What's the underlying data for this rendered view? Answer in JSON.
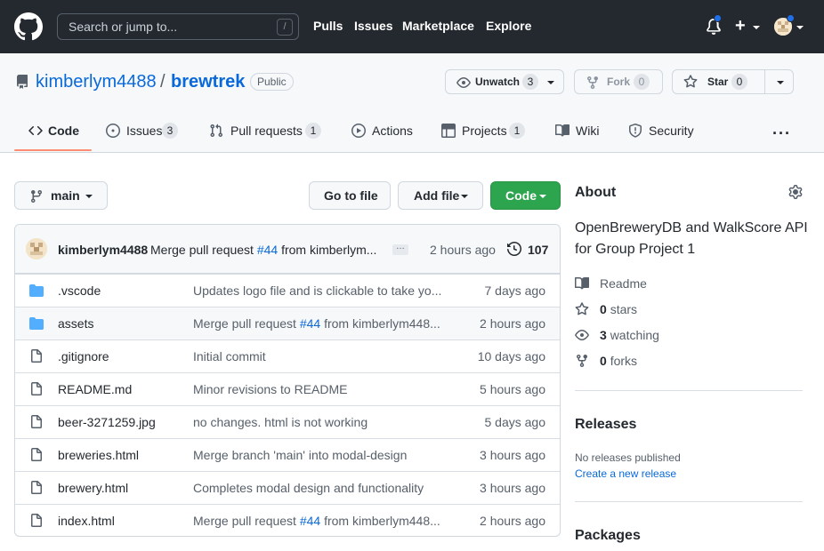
{
  "topbar": {
    "search_placeholder": "Search or jump to...",
    "slash_key": "/",
    "nav": [
      "Pulls",
      "Issues",
      "Marketplace",
      "Explore"
    ]
  },
  "repo": {
    "owner": "kimberlym4488",
    "separator": "/",
    "name": "brewtrek",
    "visibility": "Public",
    "unwatch_label": "Unwatch",
    "unwatch_count": "3",
    "fork_label": "Fork",
    "fork_count": "0",
    "star_label": "Star",
    "star_count": "0"
  },
  "tabs": [
    {
      "label": "Code",
      "icon": "code-icon"
    },
    {
      "label": "Issues",
      "count": "3",
      "icon": "issue-icon"
    },
    {
      "label": "Pull requests",
      "count": "1",
      "icon": "pull-request-icon"
    },
    {
      "label": "Actions",
      "icon": "play-icon"
    },
    {
      "label": "Projects",
      "count": "1",
      "icon": "project-icon"
    },
    {
      "label": "Wiki",
      "icon": "book-icon"
    },
    {
      "label": "Security",
      "icon": "shield-icon"
    }
  ],
  "toolbar": {
    "branch": "main",
    "go_to_file": "Go to file",
    "add_file": "Add file",
    "code": "Code"
  },
  "commit": {
    "author": "kimberlym4488",
    "message_prefix": "Merge pull request",
    "pr_link": "#44",
    "message_suffix": "from kimberlym...",
    "time": "2 hours ago",
    "count": "107"
  },
  "files": [
    {
      "type": "dir",
      "name": ".vscode",
      "message": "Updates logo file and is clickable to take yo...",
      "time": "7 days ago"
    },
    {
      "type": "dir",
      "name": "assets",
      "message_prefix": "Merge pull request ",
      "link": "#44",
      "message_suffix": " from kimberlym448...",
      "time": "2 hours ago"
    },
    {
      "type": "file",
      "name": ".gitignore",
      "message": "Initial commit",
      "time": "10 days ago"
    },
    {
      "type": "file",
      "name": "README.md",
      "message": "Minor revisions to README",
      "time": "5 hours ago"
    },
    {
      "type": "file",
      "name": "beer-3271259.jpg",
      "message": "no changes. html is not working",
      "time": "5 days ago"
    },
    {
      "type": "file",
      "name": "breweries.html",
      "message": "Merge branch 'main' into modal-design",
      "time": "3 hours ago"
    },
    {
      "type": "file",
      "name": "brewery.html",
      "message": "Completes modal design and functionality",
      "time": "3 hours ago"
    },
    {
      "type": "file",
      "name": "index.html",
      "message_prefix": "Merge pull request ",
      "link": "#44",
      "message_suffix": " from kimberlym448...",
      "time": "2 hours ago"
    }
  ],
  "about": {
    "title": "About",
    "description": "OpenBreweryDB and WalkScore API for Group Project 1",
    "readme": "Readme",
    "stars_count": "0",
    "stars_label": "stars",
    "watching_count": "3",
    "watching_label": "watching",
    "forks_count": "0",
    "forks_label": "forks"
  },
  "releases": {
    "title": "Releases",
    "none_text": "No releases published",
    "create_link": "Create a new release"
  },
  "packages": {
    "title": "Packages"
  },
  "colors": {
    "header_bg": "#24292f",
    "link": "#0969da",
    "green_button": "#2da44e",
    "active_tab": "#fd8c73",
    "folder": "#54aeff"
  }
}
